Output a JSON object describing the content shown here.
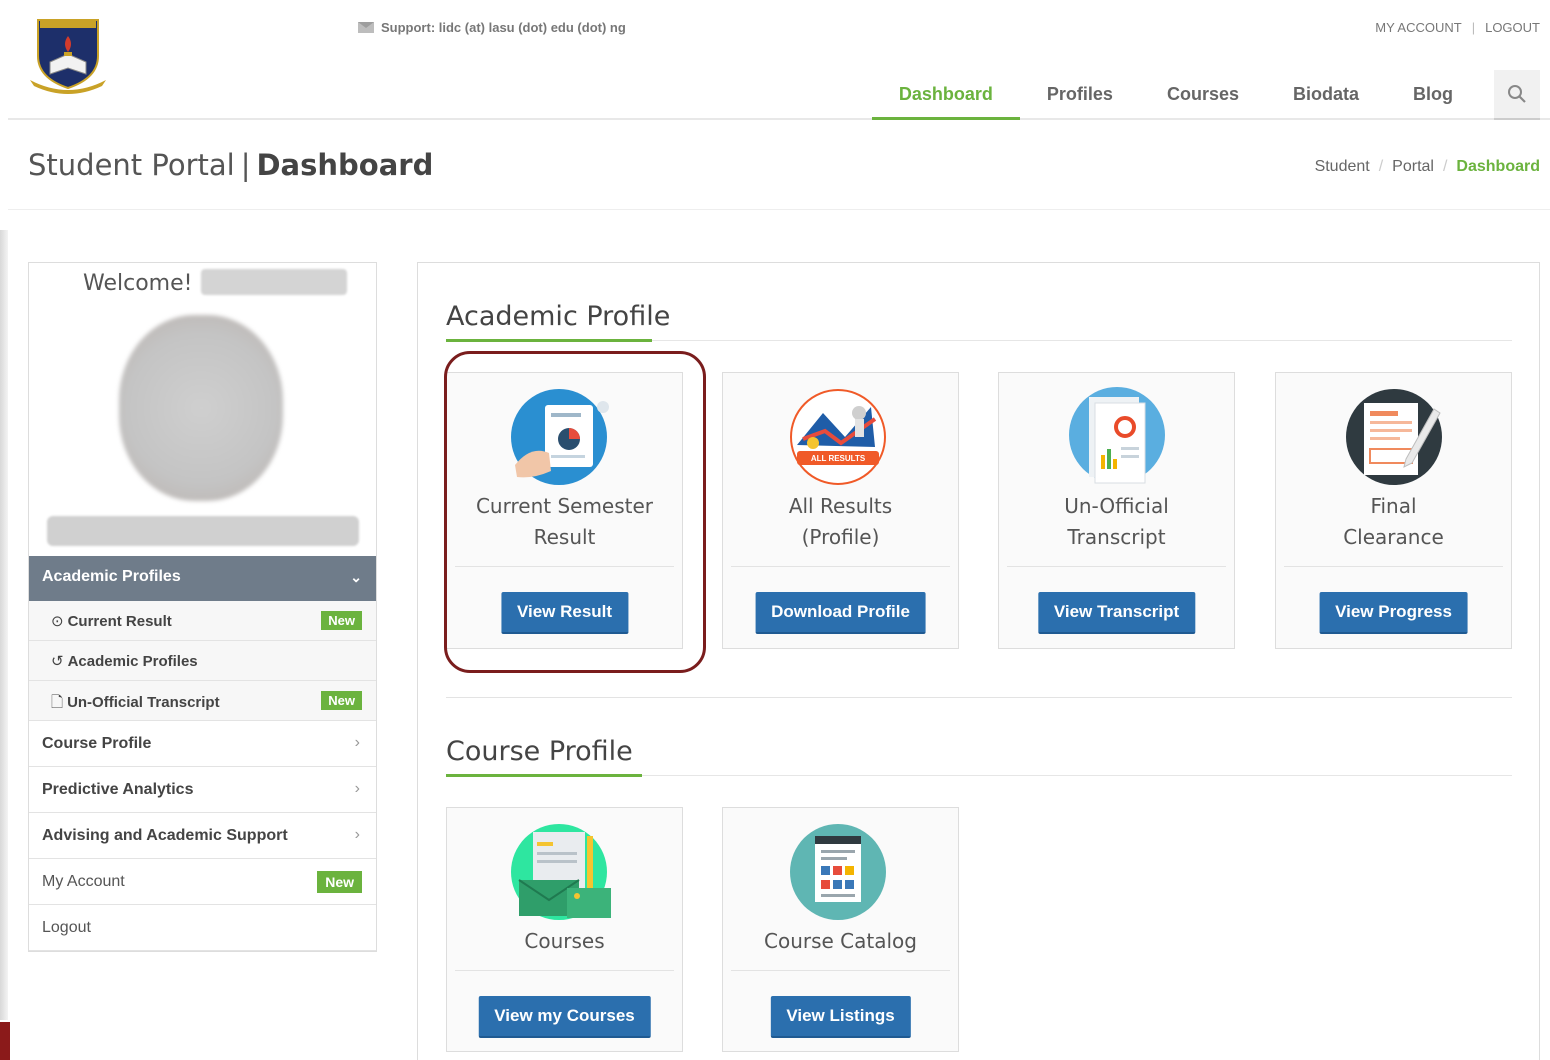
{
  "header": {
    "support_text": "Support: lidc (at) lasu (dot) edu (dot) ng",
    "my_account": "MY ACCOUNT",
    "separator": "|",
    "logout": "LOGOUT",
    "nav": [
      {
        "label": "Dashboard",
        "active": true
      },
      {
        "label": "Profiles",
        "active": false
      },
      {
        "label": "Courses",
        "active": false
      },
      {
        "label": "Biodata",
        "active": false
      },
      {
        "label": "Blog",
        "active": false
      }
    ]
  },
  "titlebar": {
    "title_left": "Student Portal",
    "title_sep": "|",
    "title_right": "Dashboard",
    "breadcrumb": [
      "Student",
      "Portal",
      "Dashboard"
    ],
    "breadcrumb_sep": "/"
  },
  "sidebar": {
    "welcome": "Welcome!",
    "section": "Academic Profiles",
    "sub_items": [
      {
        "label": "Current Result",
        "icon": "clock-icon",
        "glyph": "⊙",
        "badge": "New"
      },
      {
        "label": "Academic Profiles",
        "icon": "history-icon",
        "glyph": "↺",
        "badge": ""
      },
      {
        "label": "Un-Official Transcript",
        "icon": "document-icon",
        "glyph": "🗋",
        "badge": "New"
      }
    ],
    "menu": [
      {
        "label": "Course Profile",
        "chevron": "›"
      },
      {
        "label": "Predictive Analytics",
        "chevron": "›"
      },
      {
        "label": "Advising and Academic Support",
        "chevron": "›"
      },
      {
        "label": "My Account",
        "badge": "New"
      },
      {
        "label": "Logout"
      }
    ]
  },
  "main": {
    "academic_title": "Academic Profile",
    "academic_cards": [
      {
        "label_line1": "Current Semester",
        "label_line2": "Result",
        "button": "View Result",
        "icon": "result-chart-icon"
      },
      {
        "label_line1": "All Results",
        "label_line2": "(Profile)",
        "button": "Download Profile",
        "icon": "all-results-icon",
        "icon_text": "ALL RESULTS"
      },
      {
        "label_line1": "Un-Official",
        "label_line2": "Transcript",
        "button": "View Transcript",
        "icon": "transcript-icon"
      },
      {
        "label_line1": "Final",
        "label_line2": "Clearance",
        "button": "View Progress",
        "icon": "clearance-icon"
      }
    ],
    "course_title": "Course Profile",
    "course_cards": [
      {
        "label": "Courses",
        "button": "View my Courses",
        "icon": "courses-icon"
      },
      {
        "label": "Course Catalog",
        "button": "View Listings",
        "icon": "catalog-icon"
      }
    ]
  },
  "colors": {
    "accent_green": "#6bb33e",
    "button_blue": "#2b6fae",
    "sidebar_section": "#6f7c8a",
    "highlight_ring": "#7a1d1d"
  }
}
